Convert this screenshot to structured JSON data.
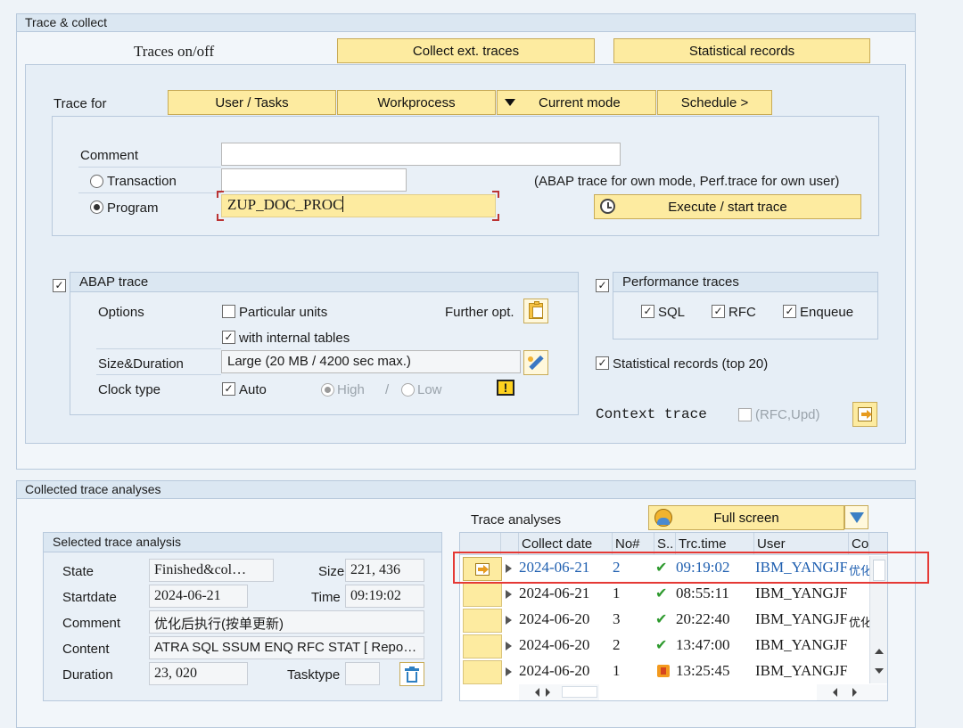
{
  "trace_collect": {
    "title": "Trace & collect",
    "traces_onoff": "Traces on/off",
    "collect_ext_traces": "Collect ext. traces",
    "statistical_records_btn": "Statistical records",
    "trace_for": {
      "label": "Trace for",
      "user_tasks": "User / Tasks",
      "workprocess": "Workprocess",
      "current_mode": "Current mode",
      "schedule": "Schedule >"
    },
    "comment_label": "Comment",
    "comment_value": "",
    "transaction_label": "Transaction",
    "transaction_value": "",
    "program_label": "Program",
    "program_value": "ZUP_DOC_PROC",
    "hint": "(ABAP trace for own mode, Perf.trace for own user)",
    "execute": "Execute / start trace",
    "abap_trace": {
      "title": "ABAP trace",
      "options_label": "Options",
      "particular_units": "Particular units",
      "further_opt": "Further opt.",
      "with_internal_tables": "with internal tables",
      "size_duration_label": "Size&Duration",
      "size_duration_value": "Large (20 MB / 4200 sec max.)",
      "clock_type_label": "Clock type",
      "auto": "Auto",
      "high": "High",
      "slash": "/",
      "low": "Low",
      "warn": "!"
    },
    "perf_traces": {
      "title": "Performance traces",
      "sql": "SQL",
      "rfc": "RFC",
      "enqueue": "Enqueue"
    },
    "stat_records_top": "Statistical records (top 20)",
    "context_trace": "Context trace",
    "context_trace_opt": "(RFC,Upd)"
  },
  "collected": {
    "title": "Collected trace analyses",
    "selected": {
      "title": "Selected trace analysis",
      "state_label": "State",
      "state_value": "Finished&col…",
      "size_label": "Size",
      "size_value": "221, 436",
      "startdate_label": "Startdate",
      "startdate_value": "2024-06-21",
      "time_label": "Time",
      "time_value": "09:19:02",
      "comment_label": "Comment",
      "comment_value": "优化后执行(按单更新)",
      "content_label": "Content",
      "content_value": "ATRA SQL SSUM ENQ RFC STAT [ Repo…",
      "duration_label": "Duration",
      "duration_value": "23, 020",
      "tasktype_label": "Tasktype",
      "tasktype_value": ""
    },
    "analyses": {
      "title": "Trace analyses",
      "full_screen": "Full screen",
      "columns": [
        "Collect date",
        "No#",
        "S..",
        "Trc.time",
        "User",
        "Co"
      ],
      "rows": [
        {
          "date": "2024-06-21",
          "no": "2",
          "time": "09:19:02",
          "user": "IBM_YANGJF",
          "co": "优化",
          "status": "ok"
        },
        {
          "date": "2024-06-21",
          "no": "1",
          "time": "08:55:11",
          "user": "IBM_YANGJF",
          "co": "",
          "status": "ok"
        },
        {
          "date": "2024-06-20",
          "no": "3",
          "time": "20:22:40",
          "user": "IBM_YANGJF",
          "co": "优化",
          "status": "ok"
        },
        {
          "date": "2024-06-20",
          "no": "2",
          "time": "13:47:00",
          "user": "IBM_YANGJF",
          "co": "",
          "status": "ok"
        },
        {
          "date": "2024-06-20",
          "no": "1",
          "time": "13:25:45",
          "user": "IBM_YANGJF",
          "co": "",
          "status": "warn"
        }
      ]
    }
  },
  "colors": {
    "button_fill": "#fdeba0",
    "panel_head": "#dbe7f2",
    "highlight_box": "#e53935",
    "ok_check": "#2e9a2e",
    "selected_text": "#1f5fb0"
  }
}
